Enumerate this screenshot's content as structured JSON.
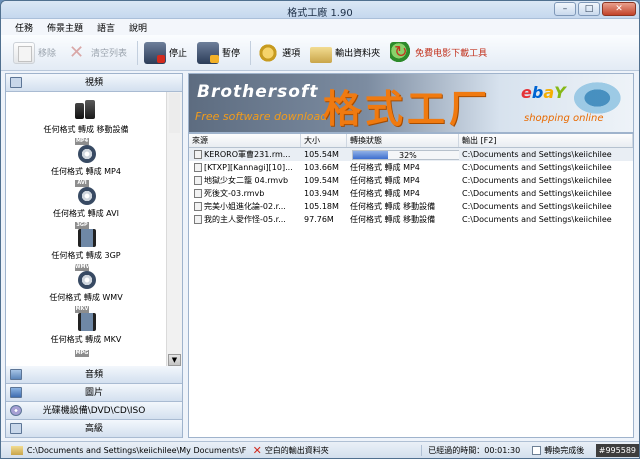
{
  "window": {
    "title": "格式工廠 1.90",
    "controls": {
      "minimize": "–",
      "maximize": "□",
      "close": "✕"
    }
  },
  "menu": [
    "任務",
    "佈景主題",
    "語言",
    "說明"
  ],
  "toolbar": {
    "remove": "移除",
    "clear_list": "清空列表",
    "stop": "停止",
    "pause": "暫停",
    "options": "選項",
    "output_folder": "輸出資料夾",
    "free_download": "免費电影下載工具"
  },
  "sidebar": {
    "video_header": "視頻",
    "video_items": [
      {
        "format": "",
        "label": "任何格式 轉成 移動設備"
      },
      {
        "format": "MP4",
        "label": "任何格式 轉成 MP4"
      },
      {
        "format": "AVI",
        "label": "任何格式 轉成 AVI"
      },
      {
        "format": "3GP",
        "label": "任何格式 轉成 3GP"
      },
      {
        "format": "WMV",
        "label": "任何格式 轉成 WMV"
      },
      {
        "format": "MKV",
        "label": "任何格式 轉成 MKV"
      },
      {
        "format": "MPG",
        "label": ""
      }
    ],
    "categories": [
      "音頻",
      "圖片",
      "光碟機設備\\DVD\\CD\\ISO",
      "高級"
    ]
  },
  "banner": {
    "brand": "Brothersoft",
    "brand_sub": "Free software download",
    "big_title": "格式工厂",
    "ebay": {
      "e": "e",
      "b": "b",
      "a": "a",
      "y": "Y"
    },
    "shop": "shopping online"
  },
  "table": {
    "headers": [
      "來源",
      "大小",
      "轉換狀態",
      "輸出 [F2]"
    ],
    "rows": [
      {
        "source": "KERORO軍曹231.rm...",
        "size": "105.54M",
        "status": "",
        "progress": 32,
        "progress_label": "32%",
        "output": "C:\\Documents and Settings\\keiichilee"
      },
      {
        "source": "[KTXP][Kannagi][10]...",
        "size": "103.66M",
        "status": "任何格式 轉成 MP4",
        "output": "C:\\Documents and Settings\\keiichilee"
      },
      {
        "source": "地獄少女二籠 04.rmvb",
        "size": "109.54M",
        "status": "任何格式 轉成 MP4",
        "output": "C:\\Documents and Settings\\keiichilee"
      },
      {
        "source": "死後文-03.rmvb",
        "size": "103.94M",
        "status": "任何格式 轉成 MP4",
        "output": "C:\\Documents and Settings\\keiichilee"
      },
      {
        "source": "完美小姐進化論-02.r...",
        "size": "105.18M",
        "status": "任何格式 轉成 移動設備",
        "output": "C:\\Documents and Settings\\keiichilee"
      },
      {
        "source": "我的主人愛作怪-05.r...",
        "size": "97.76M",
        "status": "任何格式 轉成 移動設備",
        "output": "C:\\Documents and Settings\\keiichilee"
      }
    ]
  },
  "statusbar": {
    "path": "C:\\Documents and Settings\\keiichilee\\My Documents\\FFOutput",
    "empty_output": "空白的輸出資料夾",
    "elapsed": "已經過的時間：00:01:30",
    "after_done": "轉換完成後",
    "watermark": "#995589"
  }
}
